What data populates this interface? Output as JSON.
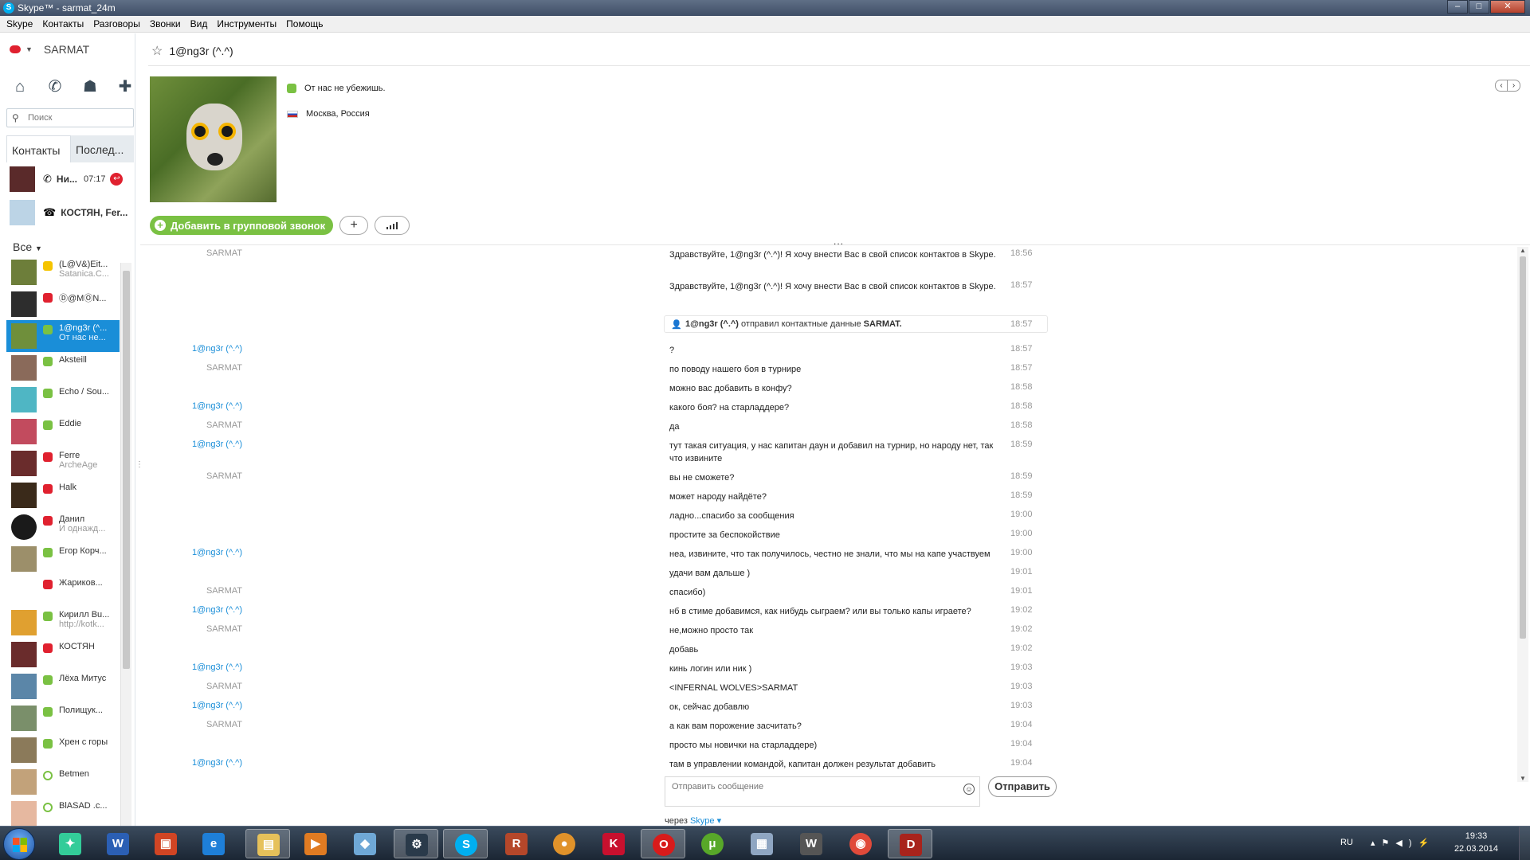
{
  "window": {
    "title": "Skype™ - sarmat_24m",
    "minimize": "–",
    "maximize": "□",
    "close": "✕"
  },
  "menu": [
    "Skype",
    "Контакты",
    "Разговоры",
    "Звонки",
    "Вид",
    "Инструменты",
    "Помощь"
  ],
  "user": {
    "name": "SARMAT",
    "status_color": "#e0212f"
  },
  "search": {
    "placeholder": "Поиск"
  },
  "tabs": {
    "contacts": "Контакты",
    "recent": "Послед..."
  },
  "recent": [
    {
      "name": "Ни...",
      "time": "07:17"
    },
    {
      "name": "КОСТЯН, Fer..."
    }
  ],
  "filter": "Все",
  "contacts": [
    {
      "name": "(L@V&)Eit...",
      "mood": "Satanica.C...",
      "status": "yellow"
    },
    {
      "name": "Ⓓ@MⓄN...",
      "mood": "",
      "status": "red"
    },
    {
      "name": "1@ng3r (^...",
      "mood": "От нас не...",
      "status": "green",
      "selected": true
    },
    {
      "name": "Aksteill",
      "mood": "",
      "status": "green"
    },
    {
      "name": "Echo / Sou...",
      "mood": "",
      "status": "green"
    },
    {
      "name": "Eddie",
      "mood": "",
      "status": "green"
    },
    {
      "name": "Ferre",
      "mood": "ArcheAge",
      "status": "red"
    },
    {
      "name": "Halk",
      "mood": "",
      "status": "red"
    },
    {
      "name": "Данил",
      "mood": "И однажд...",
      "status": "red"
    },
    {
      "name": "Егор Корч...",
      "mood": "",
      "status": "green"
    },
    {
      "name": "Жариков...",
      "mood": "",
      "status": "red"
    },
    {
      "name": "Кирилл Bu...",
      "mood": "http://kotk...",
      "status": "green"
    },
    {
      "name": "КОСТЯН",
      "mood": "",
      "status": "red"
    },
    {
      "name": "Лёха Митус",
      "mood": "",
      "status": "green"
    },
    {
      "name": "Полищук...",
      "mood": "",
      "status": "green"
    },
    {
      "name": "Хрен с горы",
      "mood": "",
      "status": "green"
    },
    {
      "name": "Betmen",
      "mood": "",
      "status": "empty"
    },
    {
      "name": "BlASAD .c...",
      "mood": "",
      "status": "empty"
    }
  ],
  "chat": {
    "title": "1@ng3r (^.^)",
    "mood": "От нас не убежишь.",
    "location": "Москва, Россия",
    "add_call_label": "Добавить в групповой звонок",
    "dots": "...",
    "system_message": {
      "name": "1@ng3r (^.^)",
      "text": "отправил контактные данные",
      "target": "SARMAT.",
      "time": "18:57"
    },
    "compose_placeholder": "Отправить сообщение",
    "send_label": "Отправить",
    "via_label": "через",
    "via_service": "Skype ▾"
  },
  "messages": [
    {
      "sender": "SARMAT",
      "them": false,
      "text": "Здравствуйте, 1@ng3r (^.^)! Я хочу внести Вас в свой список контактов в Skype.",
      "time": "18:56"
    },
    {
      "sender": "",
      "them": false,
      "text": "Здравствуйте, 1@ng3r (^.^)! Я хочу внести Вас в свой список контактов в Skype.",
      "time": "18:57"
    },
    {
      "sender": "1@ng3r (^.^)",
      "them": true,
      "text": "?",
      "time": "18:57"
    },
    {
      "sender": "SARMAT",
      "them": false,
      "text": "по поводу нашего боя в турнире",
      "time": "18:57"
    },
    {
      "sender": "",
      "them": false,
      "text": "можно вас добавить в конфу?",
      "time": "18:58"
    },
    {
      "sender": "1@ng3r (^.^)",
      "them": true,
      "text": "какого боя? на старладдере?",
      "time": "18:58"
    },
    {
      "sender": "SARMAT",
      "them": false,
      "text": "да",
      "time": "18:58"
    },
    {
      "sender": "1@ng3r (^.^)",
      "them": true,
      "text": "тут такая ситуация, у нас капитан даун и добавил на турнир, но народу нет, так что извините",
      "time": "18:59"
    },
    {
      "sender": "SARMAT",
      "them": false,
      "text": "вы не сможете?",
      "time": "18:59"
    },
    {
      "sender": "",
      "them": false,
      "text": "может народу найдёте?",
      "time": "18:59"
    },
    {
      "sender": "",
      "them": false,
      "text": "ладно...спасибо за сообщения",
      "time": "19:00"
    },
    {
      "sender": "",
      "them": false,
      "text": "простите за беспокойствие",
      "time": "19:00"
    },
    {
      "sender": "1@ng3r (^.^)",
      "them": true,
      "text": "неа, извините, что так получилось, честно не знали, что мы на капе участвуем",
      "time": "19:00"
    },
    {
      "sender": "",
      "them": true,
      "text": "удачи вам дальше )",
      "time": "19:01"
    },
    {
      "sender": "SARMAT",
      "them": false,
      "text": "спасибо)",
      "time": "19:01"
    },
    {
      "sender": "1@ng3r (^.^)",
      "them": true,
      "text": "нб в стиме добавимся, как нибудь сыграем?  или вы только капы играете?",
      "time": "19:02"
    },
    {
      "sender": "SARMAT",
      "them": false,
      "text": "не,можно просто так",
      "time": "19:02"
    },
    {
      "sender": "",
      "them": false,
      "text": "добавь",
      "time": "19:02"
    },
    {
      "sender": "1@ng3r (^.^)",
      "them": true,
      "text": "кинь логин или ник )",
      "time": "19:03"
    },
    {
      "sender": "SARMAT",
      "them": false,
      "text": "<INFERNAL WOLVES>SARMAT",
      "time": "19:03"
    },
    {
      "sender": "1@ng3r (^.^)",
      "them": true,
      "text": "ок, сейчас добавлю",
      "time": "19:03"
    },
    {
      "sender": "SARMAT",
      "them": false,
      "text": "а как вам порожение засчитать?",
      "time": "19:04"
    },
    {
      "sender": "",
      "them": false,
      "text": "просто мы новички на старладдере)",
      "time": "19:04"
    },
    {
      "sender": "1@ng3r (^.^)",
      "them": true,
      "text": "там в управлении командой, капитан должен результат добавить",
      "time": "19:04"
    }
  ],
  "taskbar": {
    "apps": [
      "start",
      "games",
      "word",
      "media-center",
      "internet-explorer",
      "explorer",
      "media-player",
      "app",
      "steam",
      "skype",
      "rust",
      "firefox-like",
      "kaspersky",
      "opera",
      "utorrent",
      "calculator",
      "world-of-tanks",
      "chrome",
      "dota2"
    ],
    "lang": "RU",
    "time": "19:33",
    "date": "22.03.2014"
  }
}
